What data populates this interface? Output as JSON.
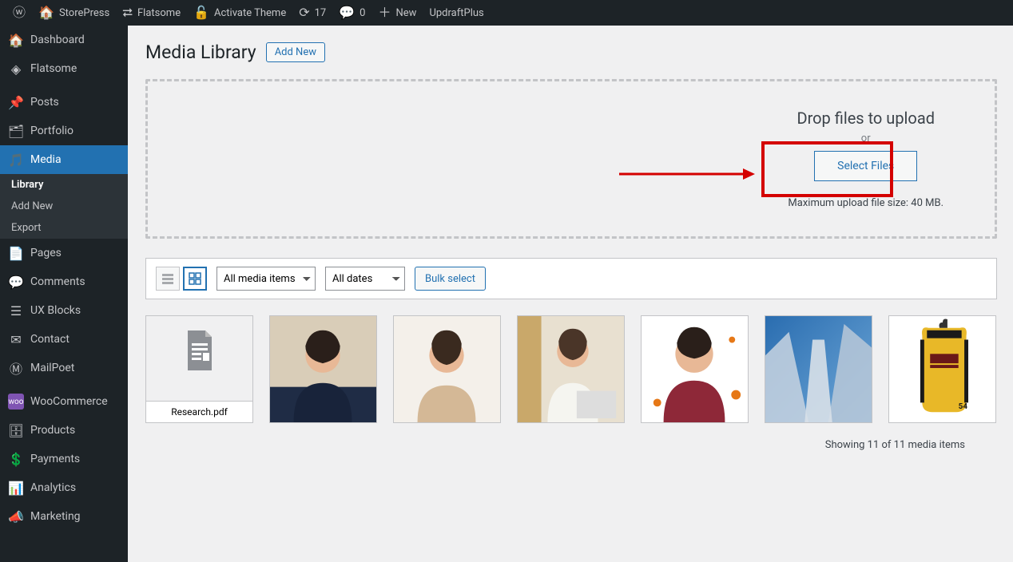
{
  "adminbar": {
    "site_name": "StorePress",
    "theme": "Flatsome",
    "activate": "Activate Theme",
    "updates": "17",
    "comments": "0",
    "new": "New",
    "updraft": "UpdraftPlus"
  },
  "sidebar": {
    "items": [
      {
        "icon": "dashboard",
        "label": "Dashboard"
      },
      {
        "icon": "flatsome",
        "label": "Flatsome"
      },
      {
        "icon": "pin",
        "label": "Posts"
      },
      {
        "icon": "portfolio",
        "label": "Portfolio"
      },
      {
        "icon": "media",
        "label": "Media",
        "active": true
      },
      {
        "icon": "page",
        "label": "Pages"
      },
      {
        "icon": "comment",
        "label": "Comments"
      },
      {
        "icon": "blocks",
        "label": "UX Blocks"
      },
      {
        "icon": "contact",
        "label": "Contact"
      },
      {
        "icon": "mailpoet",
        "label": "MailPoet"
      },
      {
        "icon": "woo",
        "label": "WooCommerce"
      },
      {
        "icon": "products",
        "label": "Products"
      },
      {
        "icon": "payments",
        "label": "Payments"
      },
      {
        "icon": "analytics",
        "label": "Analytics"
      },
      {
        "icon": "marketing",
        "label": "Marketing"
      }
    ],
    "submenu": [
      "Library",
      "Add New",
      "Export"
    ]
  },
  "page": {
    "title": "Media Library",
    "add_new": "Add New"
  },
  "dropzone": {
    "title": "Drop files to upload",
    "or": "or",
    "select": "Select Files",
    "maxsize": "Maximum upload file size: 40 MB."
  },
  "toolbar": {
    "filter_type": "All media items",
    "filter_date": "All dates",
    "bulk": "Bulk select"
  },
  "grid": {
    "file_name": "Research.pdf",
    "showing": "Showing 11 of 11 media items"
  }
}
